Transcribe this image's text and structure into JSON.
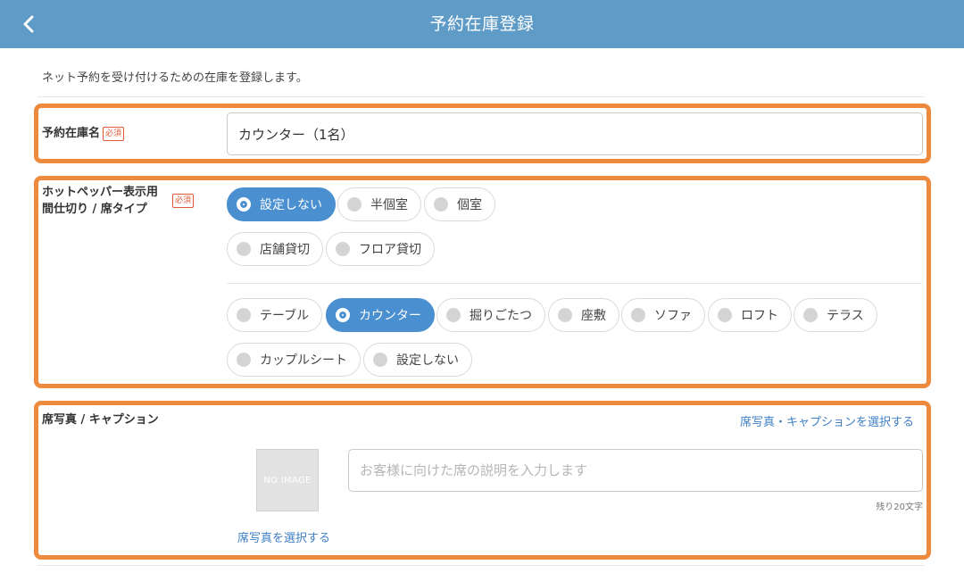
{
  "header": {
    "title": "予約在庫登録"
  },
  "description": "ネット予約を受け付けるための在庫を登録します。",
  "name_section": {
    "label": "予約在庫名",
    "required_badge": "必須",
    "value": "カウンター（1名）"
  },
  "seat_type_section": {
    "label_line1": "ホットペッパー表示用",
    "label_line2": "間仕切り / 席タイプ",
    "required_badge": "必須",
    "partition_options": [
      {
        "label": "設定しない",
        "selected": true
      },
      {
        "label": "半個室",
        "selected": false
      },
      {
        "label": "個室",
        "selected": false
      },
      {
        "label": "店舗貸切",
        "selected": false
      },
      {
        "label": "フロア貸切",
        "selected": false
      }
    ],
    "seat_options": [
      {
        "label": "テーブル",
        "selected": false
      },
      {
        "label": "カウンター",
        "selected": true
      },
      {
        "label": "掘りごたつ",
        "selected": false
      },
      {
        "label": "座敷",
        "selected": false
      },
      {
        "label": "ソファ",
        "selected": false
      },
      {
        "label": "ロフト",
        "selected": false
      },
      {
        "label": "テラス",
        "selected": false
      },
      {
        "label": "カップルシート",
        "selected": false
      },
      {
        "label": "設定しない",
        "selected": false
      }
    ]
  },
  "photo_section": {
    "label": "席写真 / キャプション",
    "select_caption_link": "席写真・キャプションを選択する",
    "no_image_text": "NO IMAGE",
    "caption_placeholder": "お客様に向けた席の説明を入力します",
    "caption_value": "",
    "remaining_chars": "残り20文字",
    "select_photo_link": "席写真を選択する"
  },
  "colors": {
    "header_bg": "#5f9bc7",
    "highlight_border": "#ee8a3d",
    "selected_pill": "#4a8fd0",
    "link": "#3f7fc4",
    "required": "#e05a3a"
  }
}
